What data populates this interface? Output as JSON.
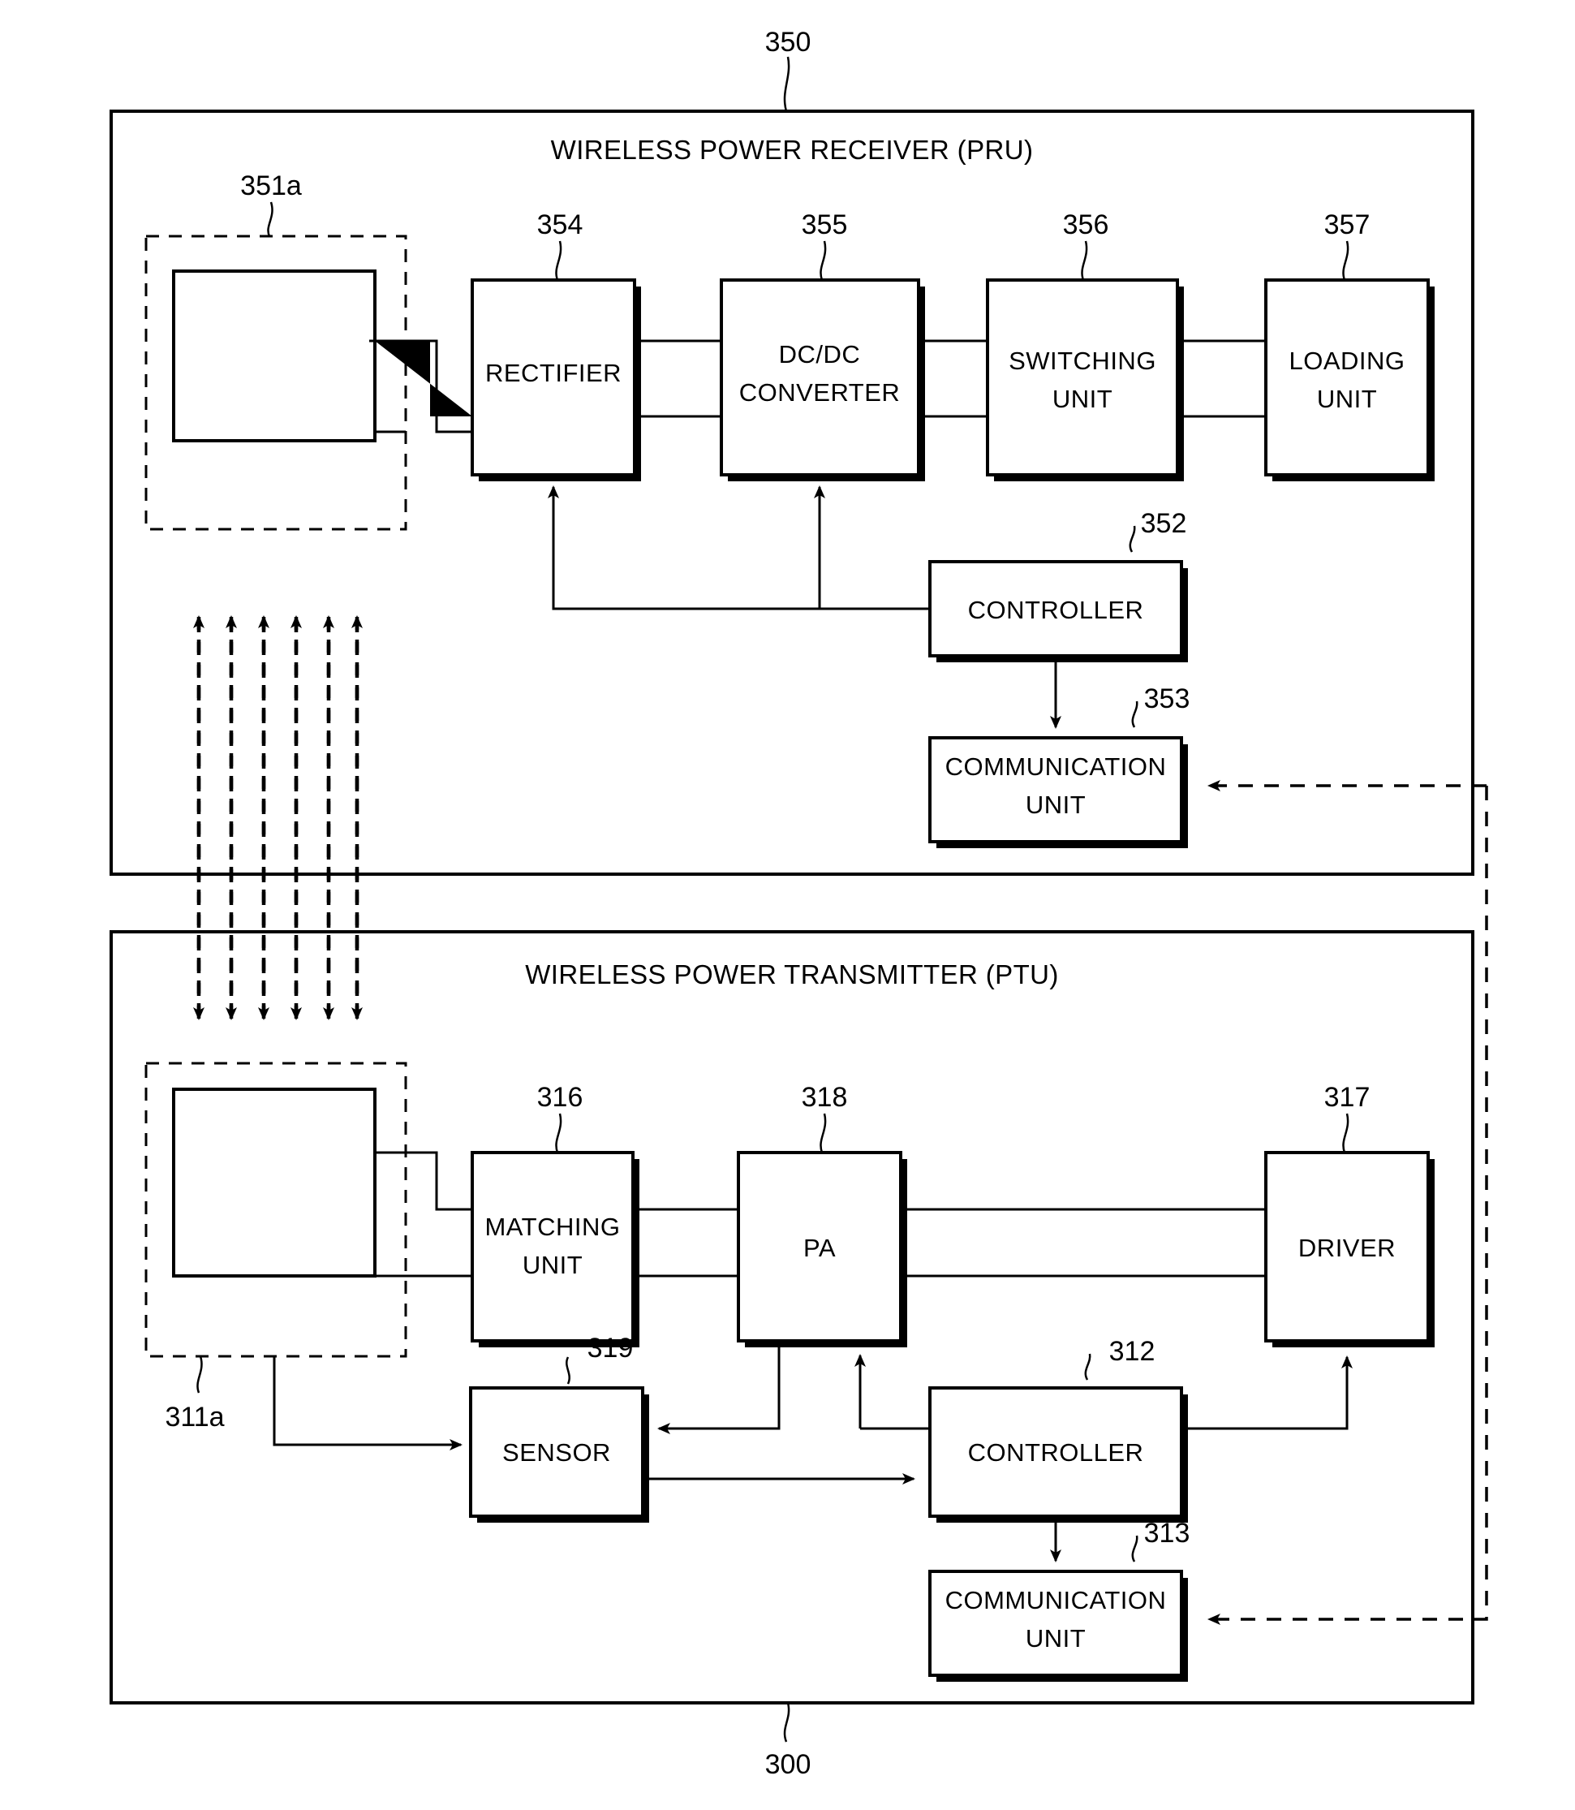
{
  "figure": {
    "kind": "patent-block-diagram",
    "colors": {
      "line": "#000000",
      "shadow": "#1a1a1a",
      "background": "#ffffff"
    }
  },
  "receiver": {
    "ref": "350",
    "title": "WIRELESS POWER RECEIVER (PRU)",
    "coil": {
      "ref": "351a"
    },
    "blocks": [
      {
        "ref": "354",
        "label_line1": "RECTIFIER",
        "label_line2": ""
      },
      {
        "ref": "355",
        "label_line1": "DC/DC",
        "label_line2": "CONVERTER"
      },
      {
        "ref": "356",
        "label_line1": "SWITCHING",
        "label_line2": "UNIT"
      },
      {
        "ref": "357",
        "label_line1": "LOADING",
        "label_line2": "UNIT"
      },
      {
        "ref": "352",
        "label_line1": "CONTROLLER",
        "label_line2": ""
      },
      {
        "ref": "353",
        "label_line1": "COMMUNICATION",
        "label_line2": "UNIT"
      }
    ]
  },
  "transmitter": {
    "ref": "300",
    "title": "WIRELESS POWER TRANSMITTER (PTU)",
    "coil": {
      "ref": "311a"
    },
    "blocks": [
      {
        "ref": "316",
        "label_line1": "MATCHING",
        "label_line2": "UNIT"
      },
      {
        "ref": "318",
        "label_line1": "PA",
        "label_line2": ""
      },
      {
        "ref": "317",
        "label_line1": "DRIVER",
        "label_line2": ""
      },
      {
        "ref": "319",
        "label_line1": "SENSOR",
        "label_line2": ""
      },
      {
        "ref": "312",
        "label_line1": "CONTROLLER",
        "label_line2": ""
      },
      {
        "ref": "313",
        "label_line1": "COMMUNICATION",
        "label_line2": "UNIT"
      }
    ]
  }
}
